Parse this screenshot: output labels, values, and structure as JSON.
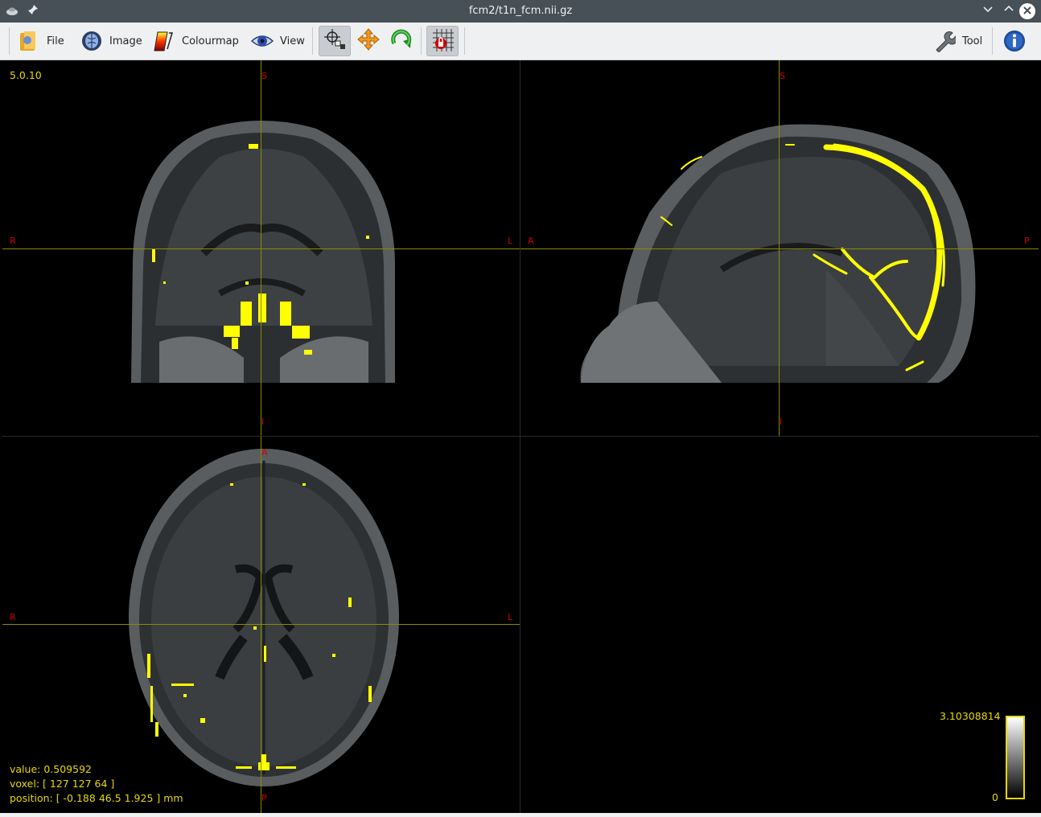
{
  "window": {
    "title": "fcm2/t1n_fcm.nii.gz",
    "controls": [
      "minimize",
      "maximize",
      "close"
    ]
  },
  "toolbar": {
    "file_label": "File",
    "image_label": "Image",
    "colourmap_label": "Colourmap",
    "view_label": "View",
    "tool_label": "Tool",
    "icons": [
      "open-folder-icon",
      "brain-image-icon",
      "colourmap-icon",
      "eye-icon",
      "crosshair-mode-icon",
      "move-icon",
      "rotate-icon",
      "lock-grid-icon",
      "wrench-icon",
      "info-icon"
    ],
    "crosshair_tool_active": true,
    "lock_tool_active": true
  },
  "viewer": {
    "version": "5.0.10",
    "overlay_color": "#ffff00",
    "crosshair_color": "#8b8b00",
    "orientation_color": "#d40000",
    "coronal": {
      "top": "S",
      "bottom": "I",
      "left": "R",
      "right": "L"
    },
    "sagittal": {
      "top": "S",
      "bottom": "I",
      "left": "A",
      "right": "P"
    },
    "axial": {
      "top": "A",
      "bottom": "P",
      "left": "R",
      "right": "L"
    },
    "info": {
      "value": "value: 0.509592",
      "voxel": "voxel: [ 127 127 64 ]",
      "position": "position: [ -0.188 46.5 1.925 ] mm"
    },
    "colorbar": {
      "max": "3.10308814",
      "min": "0"
    }
  }
}
